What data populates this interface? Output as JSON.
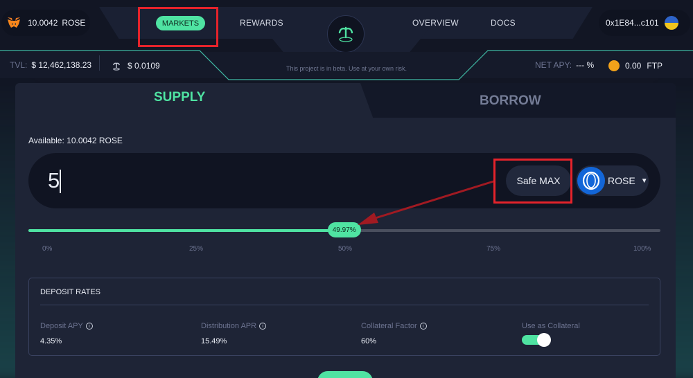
{
  "wallet": {
    "balance": "10.0042",
    "token": "ROSE",
    "icon": "metamask-fox-icon"
  },
  "nav": {
    "markets": "MARKETS",
    "rewards": "REWARDS",
    "overview": "OVERVIEW",
    "docs": "DOCS"
  },
  "account": {
    "address": "0x1E84...c101"
  },
  "stats": {
    "tvl_label": "TVL:",
    "tvl_value": "$ 12,462,138.23",
    "price_value": "$ 0.0109",
    "net_apy_label": "NET APY:",
    "net_apy_value": "--- %",
    "ftp_value": "0.00",
    "ftp_token": "FTP"
  },
  "beta_note": "This project is in beta. Use at your own risk.",
  "tabs": {
    "supply": "SUPPLY",
    "borrow": "BORROW",
    "active": "supply"
  },
  "available": "Available: 10.0042 ROSE",
  "amount": {
    "value": "5",
    "safe_max": "Safe MAX",
    "token": "ROSE"
  },
  "slider": {
    "percent_label": "49.97%",
    "percent": 49.97,
    "ticks": [
      "0%",
      "25%",
      "50%",
      "75%",
      "100%"
    ]
  },
  "deposit_rates": {
    "title": "DEPOSIT RATES",
    "deposit_apy_label": "Deposit APY",
    "deposit_apy_value": "4.35%",
    "distribution_apr_label": "Distribution APR",
    "distribution_apr_value": "15.49%",
    "collateral_factor_label": "Collateral Factor",
    "collateral_factor_value": "60%",
    "use_as_collateral_label": "Use as Collateral",
    "use_as_collateral": true,
    "info_glyph": "i"
  },
  "colors": {
    "accent": "#4fe3a2",
    "annotation": "#e5232b",
    "background": "#121624"
  }
}
